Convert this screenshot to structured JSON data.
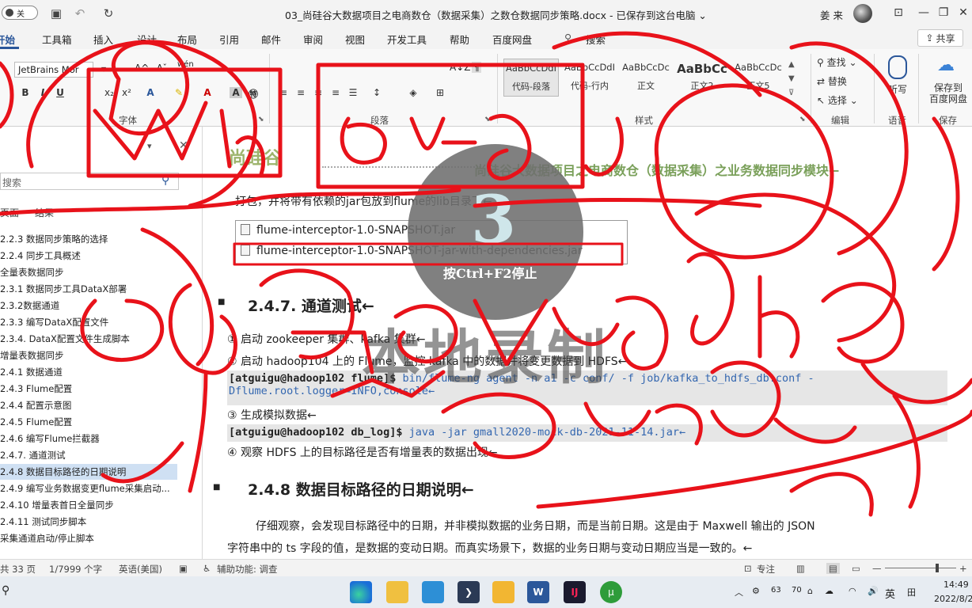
{
  "titlebar": {
    "autosave_label": "关",
    "doc_title": "03_尚硅谷大数据项目之电商数仓（数据采集）之数仓数据同步策略.docx - 已保存到这台电脑 ⌄",
    "user_name": "姜 来"
  },
  "tabs": [
    "开始",
    "插入",
    "工具箱",
    "插入",
    "设计",
    "布局",
    "引用",
    "邮件",
    "审阅",
    "视图",
    "开发工具",
    "帮助",
    "百度网盘"
  ],
  "tabs_visible": [
    "开始",
    "工具箱",
    "插入",
    "设计",
    "布局",
    "引用",
    "邮件",
    "审阅",
    "视图",
    "开发工具",
    "帮助",
    "百度网盘"
  ],
  "search_label": "搜索",
  "share_label": "共享",
  "ribbon": {
    "font_name": "JetBrains Mor",
    "font_group_label": "字体",
    "paragraph_group_label": "段落",
    "styles_group_label": "样式",
    "editing_group_label": "编辑",
    "voice_group_label": "语音",
    "save_group_label": "保存",
    "styles": [
      {
        "preview": "AaBbCcDdI",
        "name": "代码-段落"
      },
      {
        "preview": "AaBbCcDdI",
        "name": "代码-行内"
      },
      {
        "preview": "AaBbCcDc",
        "name": "正文"
      },
      {
        "preview": "AaBbCc",
        "name": "正文2"
      },
      {
        "preview": "AaBbCcDc",
        "name": "正文5"
      }
    ],
    "edit_find": "查找",
    "edit_replace": "替换",
    "edit_select": "选择",
    "dictate": "听写",
    "save_baidu": "保存到\n百度网盘"
  },
  "nav": {
    "search_placeholder": "搜索",
    "tab_pages": "页面",
    "tab_results": "结果",
    "items": [
      "2.2.3 数据同步策略的选择",
      "2.2.4 同步工具概述",
      "全量表数据同步",
      "2.3.1 数据同步工具DataX部署",
      "2.3.2数据通道",
      "2.3.3 编写DataX配置文件",
      "2.3.4. DataX配置文件生成脚本",
      "增量表数据同步",
      "2.4.1 数据通道",
      "2.4.3 Flume配置",
      "2.4.4 配置示意图",
      "2.4.5 Flume配置",
      "2.4.6 编写Flume拦截器",
      "2.4.7. 通道测试",
      "2.4.8 数据目标路径的日期说明",
      "2.4.9 编写业务数据变更flume采集启动...",
      "2.4.10 增量表首日全量同步",
      "2.4.11 测试同步脚本",
      "采集通道启动/停止脚本"
    ],
    "selected_index": 14
  },
  "document": {
    "header_logo": "尚硅谷",
    "header_title": "尚硅谷大数据项目之电商数仓（数据采集）之业务数据同步模块←",
    "line_pack": "打包，并将带有依赖的jar包放到flume的lib目录下←",
    "files": [
      "flume-interceptor-1.0-SNAPSHOT.jar",
      "flume-interceptor-1.0-SNAPSHOT-jar-with-dependencies.jar"
    ],
    "h_247": "2.4.7. 通道测试←",
    "step1": "① 启动 zookeeper 集群、kafka 集群←",
    "step2": "② 启动 hadoop104 上的 Flume，监控 kafka 中的数据并将变更数据到 HDFS←",
    "code1_prompt": "[atguigu@hadoop102 flume]$",
    "code1_cmd": " bin/flume-ng agent -n a1 -c conf/ -f job/kafka_to_hdfs_db.conf -",
    "code1_line2": "Dflume.root.logger=INFO,console←",
    "step3": "③ 生成模拟数据←",
    "code2_prompt": "[atguigu@hadoop102 db_log]$",
    "code2_cmd": " java -jar gmall2020-mock-db-2021-11-14.jar←",
    "step4": "④ 观察 HDFS 上的目标路径是否有增量表的数据出现←",
    "h_248": "2.4.8 数据目标路径的日期说明←",
    "para1": "仔细观察，会发现目标路径中的日期，并非模拟数据的业务日期，而是当前日期。这是由于 Maxwell 输出的 JSON",
    "para2": "字符串中的 ts 字段的值，是数据的变动日期。而真实场景下，数据的业务日期与变动日期应当是一致的。←",
    "watermark": "本地录制",
    "rec_number": "3",
    "rec_hint": "按Ctrl+F2停止"
  },
  "statusbar": {
    "pages": "共 33 页",
    "words": "1/7999 个字",
    "language": "英语(美国)",
    "accessibility": "辅助功能: 调查",
    "focus": "专注"
  },
  "taskbar": {
    "temp": "63",
    "cpu": "70",
    "ime": "英",
    "time": "14:49",
    "date": "2022/8/2"
  },
  "colors": {
    "accent": "#2b579a",
    "ink": "#e8121a",
    "selected_nav": "#cfe0f3"
  }
}
